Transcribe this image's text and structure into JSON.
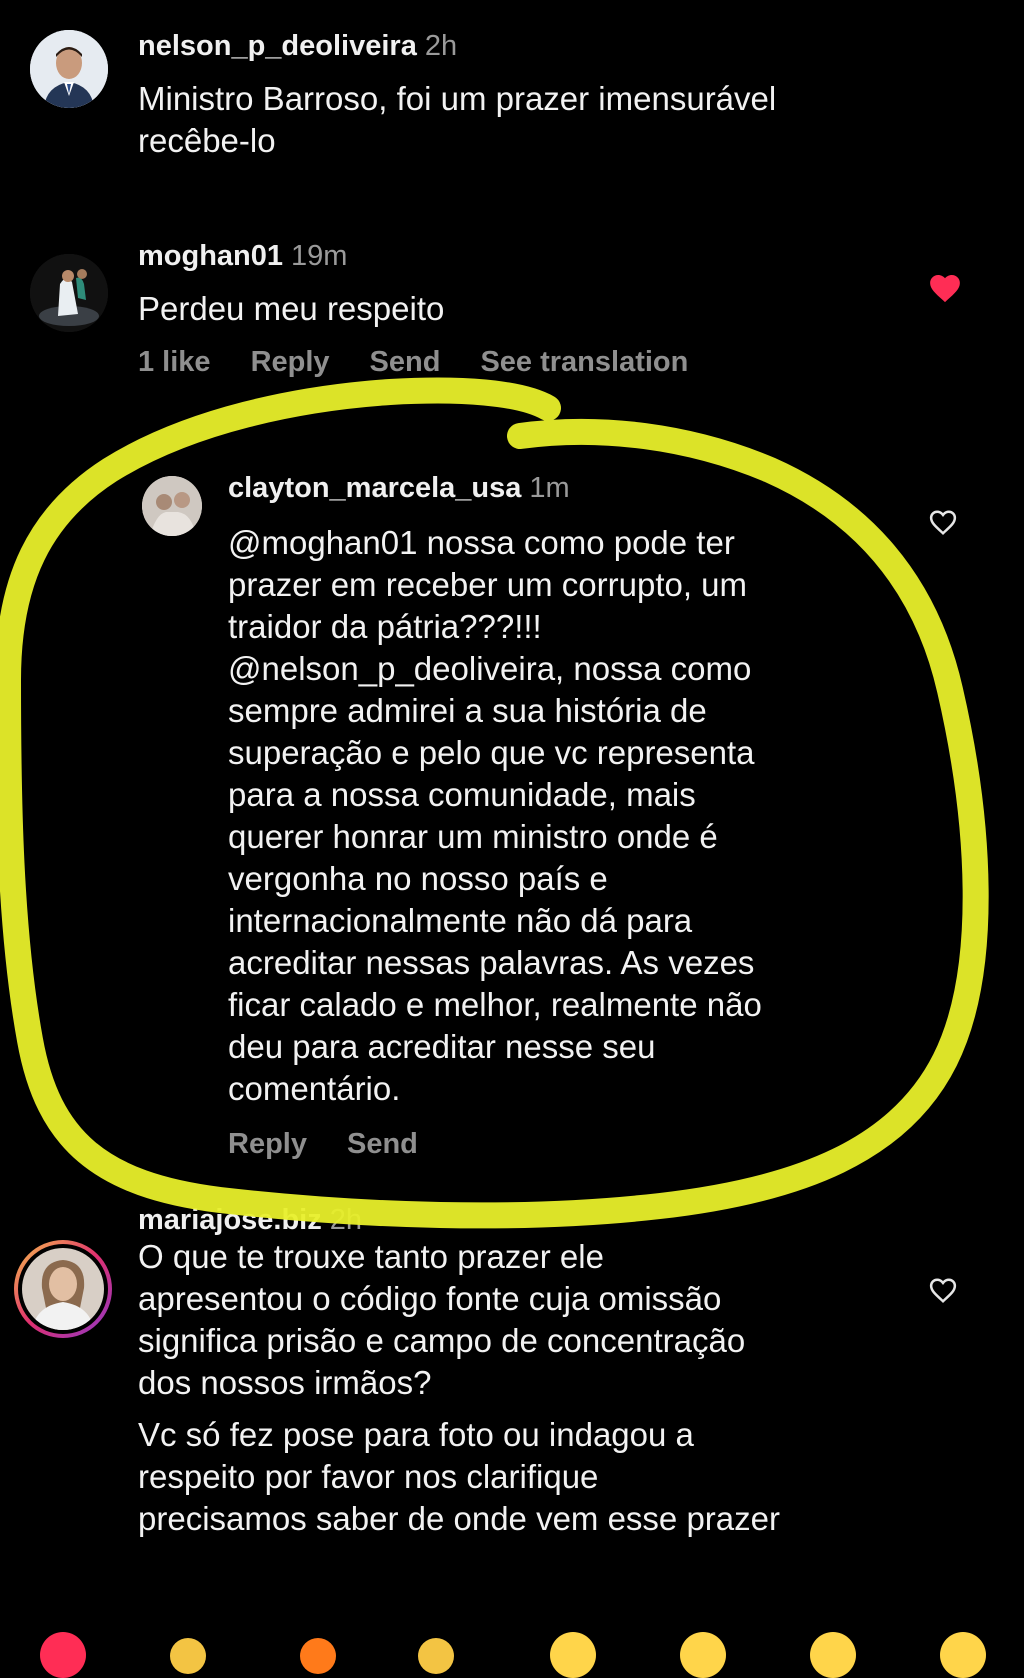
{
  "comments": [
    {
      "username": "nelson_p_deoliveira",
      "time": "2h",
      "lines": [
        "Ministro Barroso, foi um prazer imensurável",
        "recêbe-lo"
      ]
    },
    {
      "username": "moghan01",
      "time": "19m",
      "lines": [
        "Perdeu meu respeito"
      ],
      "actions": {
        "likes": "1 like",
        "reply": "Reply",
        "send": "Send",
        "translate": "See translation"
      }
    },
    {
      "username": "clayton_marcela_usa",
      "time": "1m",
      "lines": [
        "@moghan01  nossa como pode ter",
        "prazer em receber um corrupto, um",
        "traidor da pátria???!!!",
        "@nelson_p_deoliveira, nossa como",
        "sempre admirei a sua história de",
        "superação e pelo que vc representa",
        "para a nossa comunidade, mais",
        "querer honrar um ministro onde é",
        "vergonha no nosso país e",
        "internacionalmente não dá para",
        "acreditar nessas palavras. As vezes",
        "ficar calado e melhor, realmente não",
        "deu para acreditar nesse seu",
        "comentário."
      ],
      "actions": {
        "reply": "Reply",
        "send": "Send"
      }
    },
    {
      "username": "mariajose.biz",
      "time": "2h",
      "lines": [
        "O que te trouxe tanto prazer ele",
        "apresentou o código fonte cuja omissão",
        "significa prisão e campo de concentração",
        "dos nossos irmãos?"
      ],
      "lines2": [
        "Vc só fez pose para foto ou indagou a",
        "respeito por favor  nos clarifique",
        "precisamos saber de onde vem esse prazer"
      ]
    }
  ],
  "colors": {
    "background": "#000000",
    "highlight": "#e8ef2a",
    "liked_heart": "#ff2d55",
    "muted": "#8f8f8f"
  },
  "icons": [
    "heart-filled-icon",
    "heart-outline-icon"
  ]
}
